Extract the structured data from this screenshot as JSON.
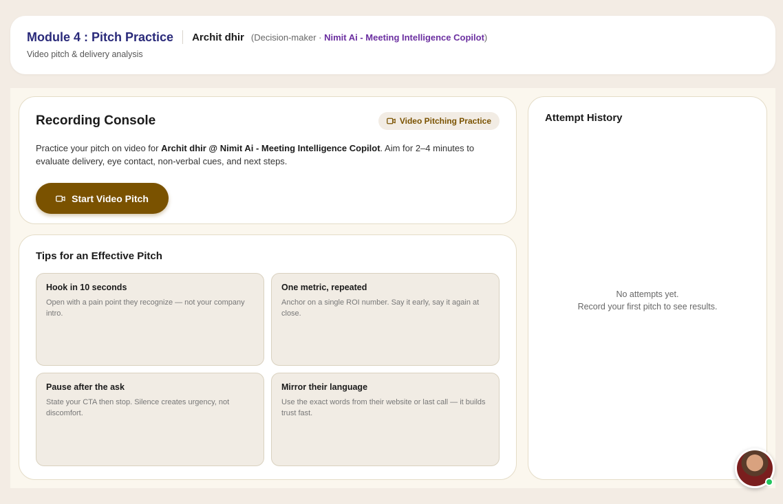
{
  "header": {
    "module_title": "Module 4 : Pitch Practice",
    "person_name": "Archit dhir",
    "role": "(Decision-maker · ",
    "company": "Nimit Ai - Meeting Intelligence Copilot",
    "close_paren": ")",
    "subtitle": "Video pitch & delivery analysis"
  },
  "console": {
    "title": "Recording Console",
    "badge_label": "Video Pitching Practice",
    "desc_prefix": "Practice your pitch on video for ",
    "desc_bold": "Archit dhir @ Nimit Ai - Meeting Intelligence Copilot",
    "desc_suffix": ". Aim for 2–4 minutes to evaluate delivery, eye contact, non-verbal cues, and next steps.",
    "start_button": "Start Video Pitch"
  },
  "tips": {
    "title": "Tips for an Effective Pitch",
    "items": [
      {
        "title": "Hook in 10 seconds",
        "text": "Open with a pain point they recognize — not your company intro."
      },
      {
        "title": "One metric, repeated",
        "text": "Anchor on a single ROI number. Say it early, say it again at close."
      },
      {
        "title": "Pause after the ask",
        "text": "State your CTA then stop. Silence creates urgency, not discomfort."
      },
      {
        "title": "Mirror their language",
        "text": "Use the exact words from their website or last call — it builds trust fast."
      }
    ]
  },
  "history": {
    "title": "Attempt History",
    "empty_line1": "No attempts yet.",
    "empty_line2": "Record your first pitch to see results."
  },
  "icons": {
    "camera": "video-camera-icon",
    "avatar": "user-avatar",
    "status": "online-status-dot"
  },
  "colors": {
    "accent": "#7a5200",
    "title_navy": "#2a2a7a",
    "company_purple": "#6b2fa0",
    "online_green": "#22c55e"
  }
}
